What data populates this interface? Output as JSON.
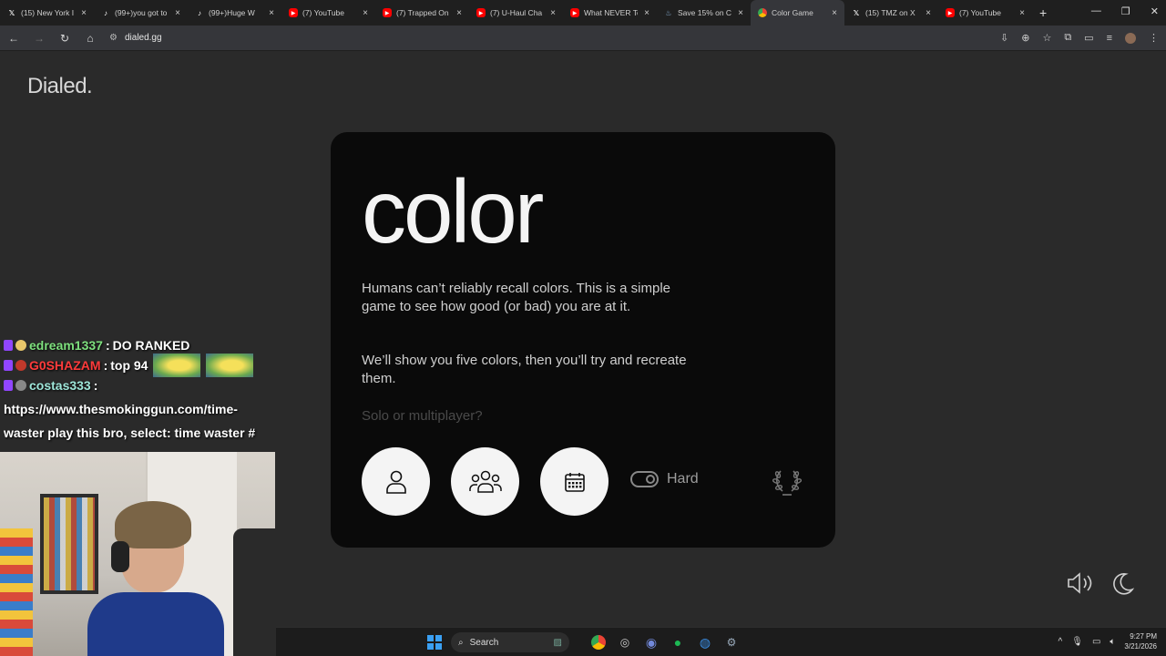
{
  "browser": {
    "tabs": [
      {
        "title": "(15) New York I",
        "favicon": "x-icon",
        "active": false
      },
      {
        "title": "(99+)you got to",
        "favicon": "tiktok-icon",
        "active": false
      },
      {
        "title": "(99+)Huge W",
        "favicon": "tiktok-icon",
        "active": false
      },
      {
        "title": "(7) YouTube",
        "favicon": "youtube-icon",
        "active": false
      },
      {
        "title": "(7) Trapped On",
        "favicon": "youtube-icon",
        "active": false
      },
      {
        "title": "(7) U-Haul Cha",
        "favicon": "youtube-icon",
        "active": false
      },
      {
        "title": "What NEVER To",
        "favicon": "youtube-icon",
        "active": false
      },
      {
        "title": "Save 15% on C",
        "favicon": "steam-icon",
        "active": false
      },
      {
        "title": "Color Game",
        "favicon": "chrome-icon",
        "active": true
      },
      {
        "title": "(15) TMZ on X",
        "favicon": "x-icon",
        "active": false
      },
      {
        "title": "(7) YouTube",
        "favicon": "youtube-icon",
        "active": false
      }
    ],
    "url": "dialed.gg"
  },
  "site": {
    "logo": "Dialed.",
    "title": "color",
    "paragraph1": "Humans can’t reliably recall colors. This is a simple game to see how good (or bad) you are at it.",
    "paragraph2": "We’ll show you five colors, then you’ll try and recreate them.",
    "prompt": "Solo or multiplayer?",
    "modes": [
      "solo-mode",
      "multiplayer-mode",
      "daily-mode"
    ],
    "toggle_label": "Hard",
    "toggle_on": true
  },
  "chat": {
    "messages": [
      {
        "user": "edream1337",
        "text": "DO RANKED",
        "color": "#7ee07e"
      },
      {
        "user": "G0SHAZAM",
        "text": "top 94",
        "color": "#ff3b3b"
      },
      {
        "user": "costas333",
        "text": "",
        "color": "#9ee6d9"
      }
    ],
    "link_text": "https://www.thesmokinggun.com/time-waster play this bro, select: time waster #"
  },
  "taskbar": {
    "search_label": "Search",
    "time": "9:27 PM",
    "date": "3/21/2026"
  },
  "colors": {
    "background": "#2a2a2a",
    "card": "#0a0a0a",
    "accent_white": "#f4f4f4"
  }
}
